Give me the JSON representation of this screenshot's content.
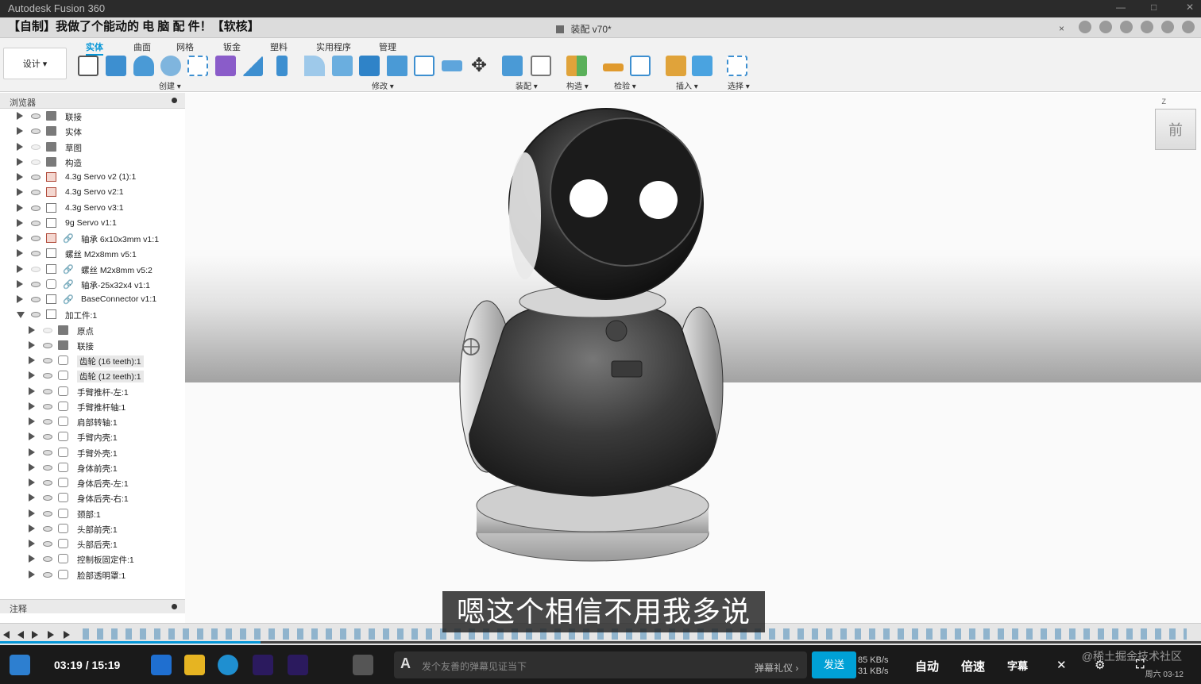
{
  "window": {
    "app_title": "Autodesk Fusion 360",
    "overlay_title": "【自制】我做了个能动的 电 脑 配 件！【软核】"
  },
  "doc_tab": {
    "label": "装配 v70*",
    "close": "×"
  },
  "toolbar": {
    "design_label": "设计 ▾",
    "tabs": [
      {
        "label": "实体",
        "active": true
      },
      {
        "label": "曲面",
        "active": false
      },
      {
        "label": "网格",
        "active": false
      },
      {
        "label": "钣金",
        "active": false
      },
      {
        "label": "塑料",
        "active": false
      },
      {
        "label": "实用程序",
        "active": false
      },
      {
        "label": "管理",
        "active": false
      }
    ],
    "groups": [
      {
        "label": "创建 ▾"
      },
      {
        "label": "修改 ▾"
      },
      {
        "label": "装配 ▾"
      },
      {
        "label": "构造 ▾"
      },
      {
        "label": "检验 ▾"
      },
      {
        "label": "插入 ▾"
      },
      {
        "label": "选择 ▾"
      }
    ]
  },
  "browser": {
    "title": "浏览器",
    "items": [
      {
        "label": "联接",
        "icon": "folder",
        "eye": true
      },
      {
        "label": "实体",
        "icon": "folder",
        "eye": true
      },
      {
        "label": "草图",
        "icon": "folder",
        "eye": false
      },
      {
        "label": "构造",
        "icon": "folder",
        "eye": false
      },
      {
        "label": "4.3g Servo v2 (1):1",
        "icon": "comp-red",
        "eye": true
      },
      {
        "label": "4.3g Servo v2:1",
        "icon": "comp-red",
        "eye": true
      },
      {
        "label": "4.3g Servo v3:1",
        "icon": "comp",
        "eye": true
      },
      {
        "label": "9g Servo v1:1",
        "icon": "comp",
        "eye": true
      },
      {
        "label": "轴承 6x10x3mm v1:1",
        "icon": "comp-red",
        "eye": true,
        "link": true
      },
      {
        "label": "螺丝 M2x8mm v5:1",
        "icon": "comp",
        "eye": true
      },
      {
        "label": "螺丝 M2x8mm v5:2",
        "icon": "comp",
        "eye": false,
        "link": true
      },
      {
        "label": "轴承-25x32x4 v1:1",
        "icon": "body",
        "eye": true,
        "link": true
      },
      {
        "label": "BaseConnector v1:1",
        "icon": "comp",
        "eye": true,
        "link": true
      },
      {
        "label": "加工件:1",
        "icon": "comp",
        "eye": true,
        "open": true
      },
      {
        "label": "原点",
        "icon": "folder",
        "eye": false,
        "indent": 1
      },
      {
        "label": "联接",
        "icon": "folder",
        "eye": true,
        "indent": 1
      },
      {
        "label": "齿轮 (16 teeth):1",
        "icon": "body",
        "eye": true,
        "indent": 1,
        "selected": true
      },
      {
        "label": "齿轮 (12 teeth):1",
        "icon": "body",
        "eye": true,
        "indent": 1,
        "selected": true
      },
      {
        "label": "手臂推杆-左:1",
        "icon": "body",
        "eye": true,
        "indent": 1
      },
      {
        "label": "手臂推杆轴:1",
        "icon": "body",
        "eye": true,
        "indent": 1
      },
      {
        "label": "肩部转轴:1",
        "icon": "body",
        "eye": true,
        "indent": 1
      },
      {
        "label": "手臂内壳:1",
        "icon": "body",
        "eye": true,
        "indent": 1
      },
      {
        "label": "手臂外壳:1",
        "icon": "body",
        "eye": true,
        "indent": 1
      },
      {
        "label": "身体前壳:1",
        "icon": "body",
        "eye": true,
        "indent": 1
      },
      {
        "label": "身体后壳-左:1",
        "icon": "body",
        "eye": true,
        "indent": 1
      },
      {
        "label": "身体后壳-右:1",
        "icon": "body",
        "eye": true,
        "indent": 1
      },
      {
        "label": "颈部:1",
        "icon": "body",
        "eye": true,
        "indent": 1
      },
      {
        "label": "头部前壳:1",
        "icon": "body",
        "eye": true,
        "indent": 1
      },
      {
        "label": "头部后壳:1",
        "icon": "body",
        "eye": true,
        "indent": 1
      },
      {
        "label": "控制板固定件:1",
        "icon": "body",
        "eye": true,
        "indent": 1
      },
      {
        "label": "脸部透明罩:1",
        "icon": "body",
        "eye": true,
        "indent": 1
      }
    ]
  },
  "annotations": {
    "title": "注释"
  },
  "viewport": {
    "viewcube_face": "前",
    "axis_label": "Z"
  },
  "subtitle": {
    "text": "嗯这个相信不用我多说"
  },
  "player": {
    "time": "03:19 / 15:19",
    "progress": 0.217,
    "danmu_placeholder": "发个友善的弹幕见证当下",
    "danmu_icon": "A",
    "gift": "弹幕礼仪 ›",
    "send": "发送",
    "net_up": "85 KB/s",
    "net_down": "31 KB/s",
    "auto": "自动",
    "speed": "倍速",
    "subtitle_btn": "字幕",
    "watermark": "@稀土掘金技术社区",
    "date": "周六 03-12"
  },
  "colors": {
    "accent": "#0696d7",
    "send": "#00a1d6",
    "taskbar": "#1a1a1a"
  }
}
